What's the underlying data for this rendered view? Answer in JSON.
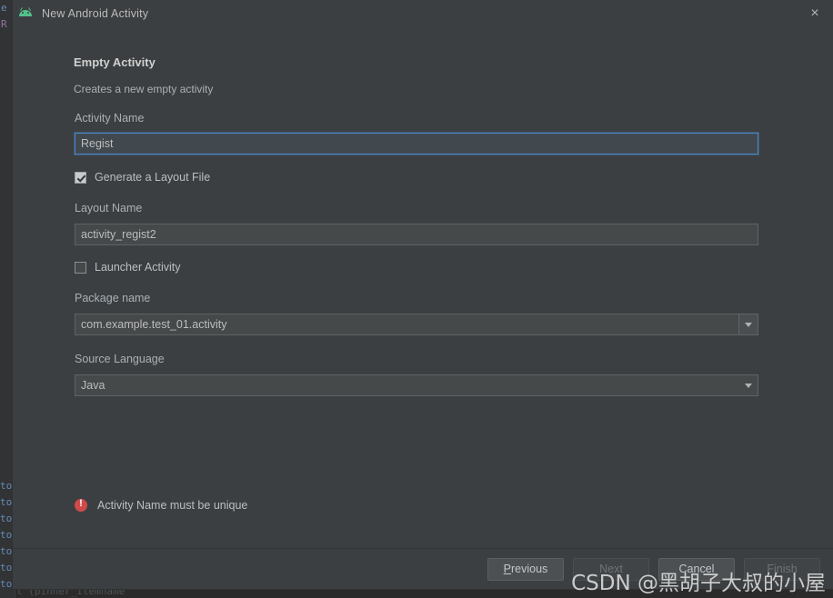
{
  "window": {
    "title": "New Android Activity",
    "app_icon": "android-icon",
    "close_icon": "×"
  },
  "form": {
    "section_title": "Empty Activity",
    "section_subtitle": "Creates a new empty activity",
    "activity_name": {
      "label": "Activity Name",
      "value": "Regist",
      "focused": true
    },
    "generate_layout": {
      "label": "Generate a Layout File",
      "checked": true
    },
    "layout_name": {
      "label": "Layout Name",
      "value": "activity_regist2"
    },
    "launcher_activity": {
      "label": "Launcher Activity",
      "checked": false
    },
    "package_name": {
      "label": "Package name",
      "value": "com.example.test_01.activity"
    },
    "source_language": {
      "label": "Source Language",
      "value": "Java"
    }
  },
  "validation": {
    "icon": "error-icon",
    "message": "Activity Name must be unique"
  },
  "buttons": {
    "previous": {
      "mnemonic": "P",
      "rest": "revious",
      "disabled": false
    },
    "next": {
      "label": "Next",
      "disabled": true
    },
    "cancel": {
      "label": "Cancel",
      "disabled": false
    },
    "finish": {
      "label": "Finish",
      "disabled": true
    }
  },
  "watermark": {
    "text": "CSDN @黑胡子大叔的小屋"
  },
  "background": {
    "fragments": [
      {
        "text": "e",
        "color": "blue"
      },
      {
        "text": "R",
        "color": "purple"
      },
      {
        "text": "to",
        "color": "blue"
      },
      {
        "text": "to",
        "color": "blue"
      },
      {
        "text": "to",
        "color": "blue"
      },
      {
        "text": "to",
        "color": "blue"
      },
      {
        "text": "to",
        "color": "blue"
      },
      {
        "text": "to",
        "color": "blue"
      },
      {
        "text": "to",
        "color": "blue"
      },
      {
        "text": "t (pinner_itemname",
        "color": "gray"
      }
    ]
  },
  "colors": {
    "dialog_bg": "#3c3f41",
    "input_bg": "#45494a",
    "focus_border": "#4a88c7",
    "error_red": "#cf4b4b",
    "android_green": "#53c08a",
    "text_primary": "#bdbdbd",
    "text_label": "#a9b0b6"
  }
}
